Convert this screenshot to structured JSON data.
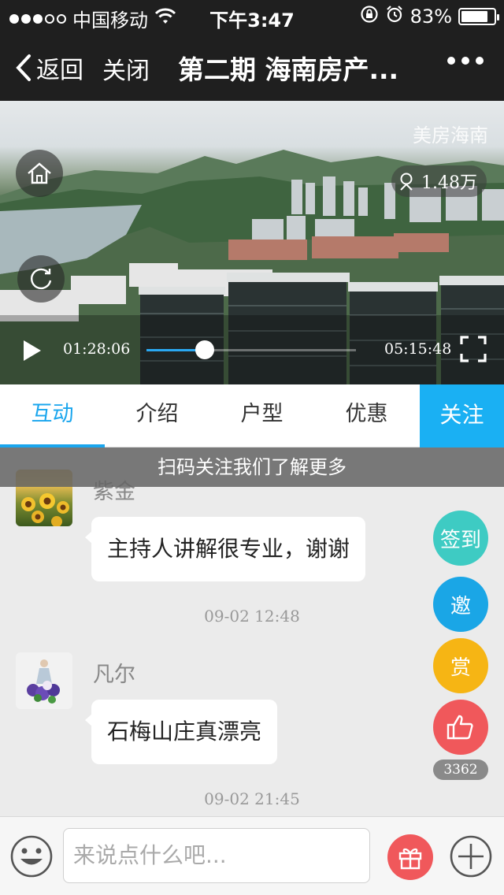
{
  "status_bar": {
    "carrier": "中国移动",
    "time": "下午3:47",
    "battery": "83%",
    "battery_level": 0.83
  },
  "nav": {
    "back_label": "返回",
    "close_label": "关闭",
    "title": "第二期 海南房产..."
  },
  "video": {
    "watermark": "美房海南",
    "viewers": "1.48万",
    "current_time": "01:28:06",
    "total_time": "05:15:48",
    "progress": 0.28
  },
  "tabs": [
    {
      "label": "互动",
      "active": true
    },
    {
      "label": "介绍",
      "active": false
    },
    {
      "label": "户型",
      "active": false
    },
    {
      "label": "优惠",
      "active": false
    }
  ],
  "follow_label": "关注",
  "banner": "扫码关注我们了解更多",
  "messages": [
    {
      "user": "紫金",
      "text": "主持人讲解很专业，谢谢",
      "time": "09-02 12:48"
    },
    {
      "user": "凡尔",
      "text": "石梅山庄真漂亮",
      "time": "09-02 21:45"
    }
  ],
  "side_buttons": {
    "checkin": "签到",
    "invite": "邀",
    "reward": "赏",
    "like_count": "3362"
  },
  "colors": {
    "accent": "#1aa6ee",
    "checkin": "#3ecbc3",
    "invite": "#1aa6e6",
    "reward": "#f6b514",
    "like": "#f0585b"
  },
  "input": {
    "placeholder": "来说点什么吧..."
  }
}
